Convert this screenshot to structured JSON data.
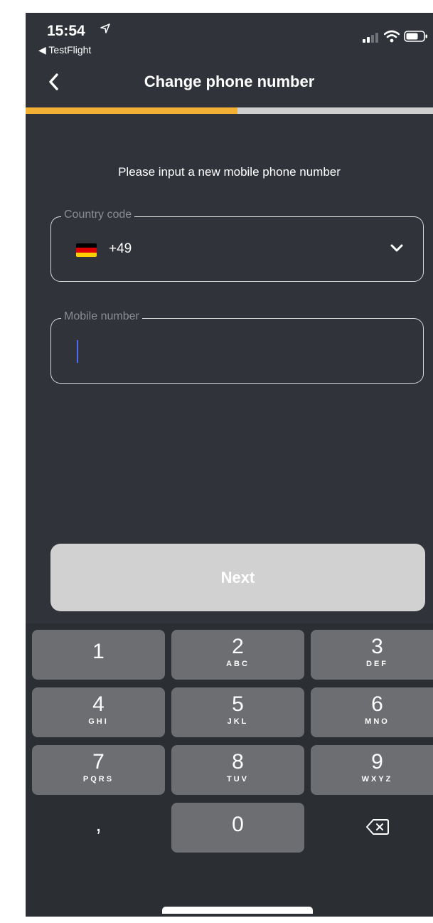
{
  "status_bar": {
    "time": "15:54",
    "back_app": "◀ TestFlight"
  },
  "nav": {
    "title": "Change phone number"
  },
  "progress": {
    "fraction": 0.52,
    "fill_color": "#f2b134",
    "track_color": "#cfcfcf"
  },
  "form": {
    "instruction": "Please input a new mobile phone number",
    "country_code_label": "Country code",
    "country_code_value": "+49",
    "country_flag": "germany-flag",
    "mobile_number_label": "Mobile number",
    "mobile_number_value": ""
  },
  "next_button": {
    "label": "Next"
  },
  "keypad": {
    "keys": [
      {
        "digit": "1",
        "letters": ""
      },
      {
        "digit": "2",
        "letters": "ABC"
      },
      {
        "digit": "3",
        "letters": "DEF"
      },
      {
        "digit": "4",
        "letters": "GHI"
      },
      {
        "digit": "5",
        "letters": "JKL"
      },
      {
        "digit": "6",
        "letters": "MNO"
      },
      {
        "digit": "7",
        "letters": "PQRS"
      },
      {
        "digit": "8",
        "letters": "TUV"
      },
      {
        "digit": "9",
        "letters": "WXYZ"
      },
      {
        "digit": ",",
        "letters": ""
      },
      {
        "digit": "0",
        "letters": ""
      }
    ]
  },
  "colors": {
    "background": "#30333a",
    "accent": "#f2b134",
    "button_disabled": "#d1d1d1",
    "caret": "#4a6cf7"
  }
}
